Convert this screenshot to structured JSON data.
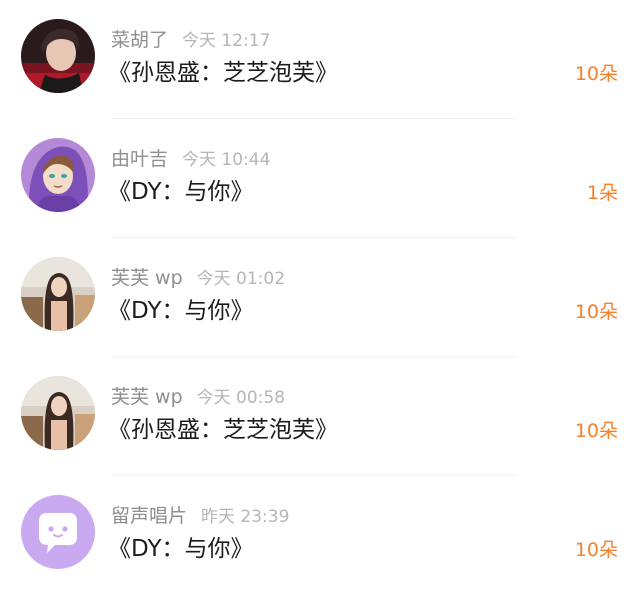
{
  "messages": [
    {
      "name": "菜胡了",
      "time": "今天 12:17",
      "content": "《孙恩盛：芝芝泡芙》",
      "gift": "10朵",
      "avatar_icon": "user-photo-avatar"
    },
    {
      "name": "由叶吉",
      "time": "今天 10:44",
      "content": "《DY：与你》",
      "gift": "1朵",
      "avatar_icon": "anime-character-avatar"
    },
    {
      "name": "芙芙 wp",
      "time": "今天 01:02",
      "content": "《DY：与你》",
      "gift": "10朵",
      "avatar_icon": "user-photo-avatar"
    },
    {
      "name": "芙芙 wp",
      "time": "今天 00:58",
      "content": "《孙恩盛：芝芝泡芙》",
      "gift": "10朵",
      "avatar_icon": "user-photo-avatar"
    },
    {
      "name": "留声唱片",
      "time": "昨天 23:39",
      "content": "《DY：与你》",
      "gift": "10朵",
      "avatar_icon": "chat-bubble-avatar"
    }
  ],
  "colors": {
    "gift_accent": "#f5812c",
    "name_gray": "#8e8e93",
    "time_gray": "#b5b5ba",
    "text_dark": "#1c1c1e",
    "avatar_purple": "#c9a9f0"
  }
}
